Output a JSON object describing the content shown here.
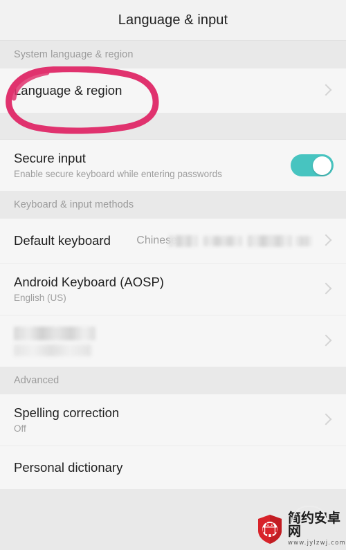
{
  "header": {
    "title": "Language & input"
  },
  "sections": [
    {
      "id": "system-language-region",
      "label": "System language & region",
      "rows": [
        {
          "id": "language-region",
          "primary": "Language & region",
          "secondary": "",
          "value": "",
          "chevron": true,
          "highlighted": true
        }
      ]
    },
    {
      "id": "secure-input-group",
      "label": "",
      "rows": [
        {
          "id": "secure-input",
          "primary": "Secure input",
          "secondary": "Enable secure keyboard while entering passwords",
          "value": "",
          "toggle": true,
          "toggle_on": true
        }
      ]
    },
    {
      "id": "keyboard-input-methods",
      "label": "Keyboard & input methods",
      "rows": [
        {
          "id": "default-keyboard",
          "primary": "Default keyboard",
          "secondary": "",
          "value": "Chinese",
          "value_redacted": true,
          "chevron": true
        },
        {
          "id": "android-keyboard-aosp",
          "primary": "Android Keyboard (AOSP)",
          "secondary": "English (US)",
          "value": "",
          "chevron": true
        },
        {
          "id": "redacted-input-method",
          "primary": "",
          "secondary": "",
          "value": "",
          "chevron": true,
          "fully_redacted": true
        }
      ]
    },
    {
      "id": "advanced",
      "label": "Advanced",
      "rows": [
        {
          "id": "spelling-correction",
          "primary": "Spelling correction",
          "secondary": "Off",
          "value": "",
          "chevron": true
        },
        {
          "id": "personal-dictionary",
          "primary": "Personal dictionary",
          "secondary": "",
          "value": "",
          "chevron": false
        }
      ]
    }
  ],
  "annotation": {
    "shape": "hand-drawn-ellipse",
    "target": "Language & region",
    "color": "#E0326E"
  },
  "watermark": {
    "site_name": "简约安卓网",
    "url": "www.jylzwj.com",
    "logo_color": "#D8232A"
  },
  "colors": {
    "accent_toggle": "#47C4C0",
    "annotation_pink": "#E0326E",
    "row_bg": "#F6F6F6",
    "section_bg": "#E9E9E9",
    "title_bg": "#F2F2F2",
    "primary_text": "#1f1f1f",
    "secondary_text": "#9e9e9e"
  }
}
